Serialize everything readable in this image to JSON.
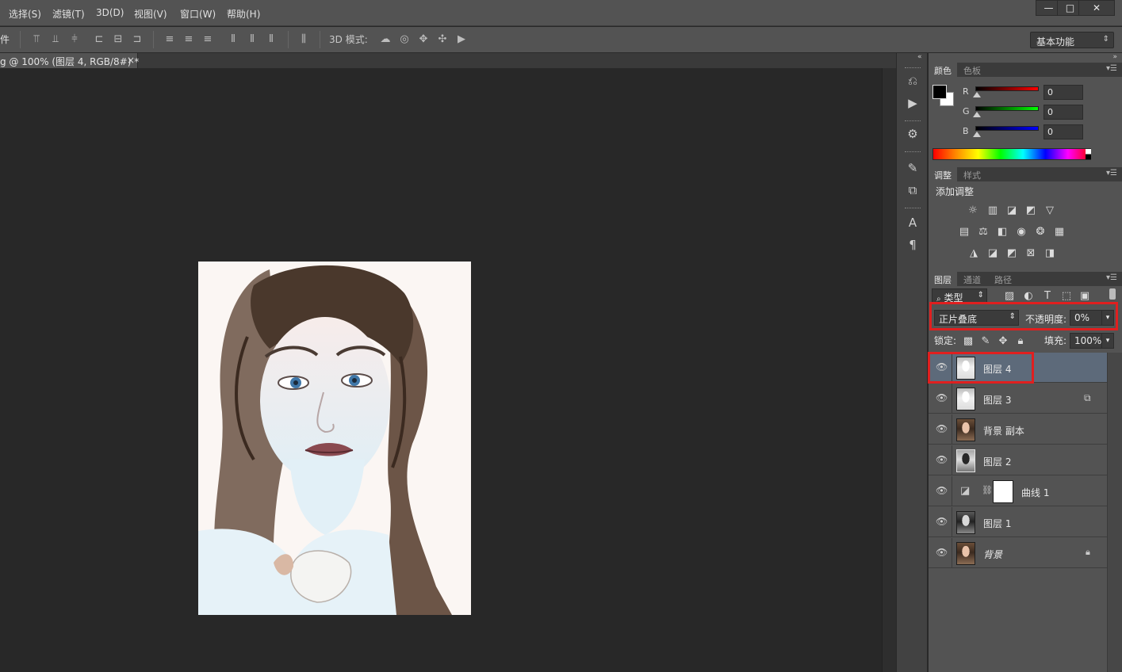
{
  "menu": {
    "items": [
      "选择(S)",
      "滤镜(T)",
      "3D(D)",
      "视图(V)",
      "窗口(W)",
      "帮助(H)"
    ],
    "window_controls": [
      "—",
      "□",
      "✕"
    ]
  },
  "options_bar": {
    "left_label": "件",
    "mode_label": "3D 模式:",
    "workspace": "基本功能"
  },
  "document_tab": {
    "title": "g @ 100% (图层 4, RGB/8#) *",
    "close": "×"
  },
  "color_panel": {
    "tabs": [
      "颜色",
      "色板"
    ],
    "channels": [
      {
        "label": "R",
        "value": "0"
      },
      {
        "label": "G",
        "value": "0"
      },
      {
        "label": "B",
        "value": "0"
      }
    ]
  },
  "adjustments_panel": {
    "tabs": [
      "调整",
      "样式"
    ],
    "heading": "添加调整"
  },
  "layers_panel": {
    "tabs": [
      "图层",
      "通道",
      "路径"
    ],
    "filter_kind": "类型",
    "blend_mode": "正片叠底",
    "opacity_label": "不透明度:",
    "opacity_value": "0%",
    "lock_label": "锁定:",
    "fill_label": "填充:",
    "fill_value": "100%",
    "layers": [
      {
        "name": "图层 4",
        "selected": true
      },
      {
        "name": "图层 3",
        "selected": false
      },
      {
        "name": "背景 副本",
        "selected": false
      },
      {
        "name": "图层 2",
        "selected": false
      },
      {
        "name": "曲线 1",
        "selected": false
      },
      {
        "name": "图层 1",
        "selected": false
      },
      {
        "name": "背景",
        "selected": false
      }
    ]
  },
  "colors": {
    "accent_highlight": "#e01f1f",
    "selected_row": "#5d6a7a",
    "panel_bg": "#535353",
    "canvas_bg": "#282828"
  },
  "icons": {
    "panel_collapse": "collapse-arrows-icon",
    "visibility": "eye-icon"
  }
}
